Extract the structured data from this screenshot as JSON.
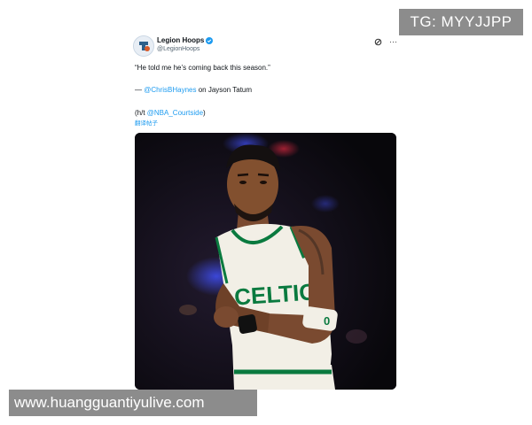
{
  "watermark_top": "TG: MYYJJPP",
  "watermark_bottom": "www.huangguantiyulive.com",
  "tweet": {
    "display_name": "Legion Hoops",
    "handle": "@LegionHoops",
    "quote": "“He told me he’s coming back this season.”",
    "credit_prefix": "— ",
    "credit_mention": "@ChrisBHaynes",
    "credit_suffix": " on Jayson Tatum",
    "ht_prefix": "(h/t ",
    "ht_mention": "@NBA_Courtside",
    "ht_suffix": ")",
    "translate": "翻译帖子",
    "more": "···"
  },
  "media": {
    "jersey_text": "CELTICS",
    "armband_number": "0"
  },
  "colors": {
    "link": "#1d9bf0",
    "celtics_green": "#0a7a3f",
    "watermark_bg": "#8c8c8c"
  }
}
